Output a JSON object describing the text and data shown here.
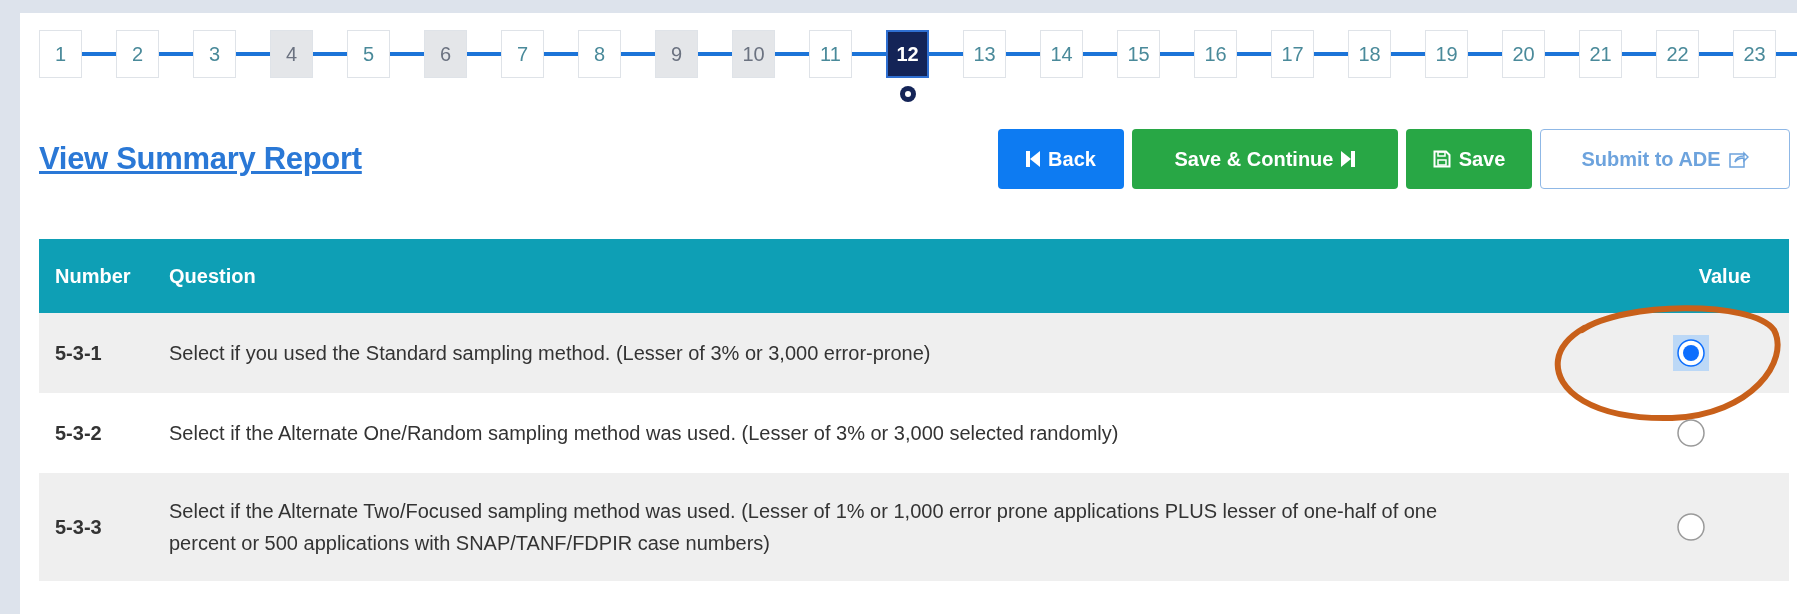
{
  "steps": [
    {
      "label": "1",
      "selected": false,
      "greyed": false
    },
    {
      "label": "2",
      "selected": false,
      "greyed": false
    },
    {
      "label": "3",
      "selected": false,
      "greyed": false
    },
    {
      "label": "4",
      "selected": false,
      "greyed": true
    },
    {
      "label": "5",
      "selected": false,
      "greyed": false
    },
    {
      "label": "6",
      "selected": false,
      "greyed": true
    },
    {
      "label": "7",
      "selected": false,
      "greyed": false
    },
    {
      "label": "8",
      "selected": false,
      "greyed": false
    },
    {
      "label": "9",
      "selected": false,
      "greyed": true
    },
    {
      "label": "10",
      "selected": false,
      "greyed": true
    },
    {
      "label": "11",
      "selected": false,
      "greyed": false
    },
    {
      "label": "12",
      "selected": true,
      "greyed": false
    },
    {
      "label": "13",
      "selected": false,
      "greyed": false
    },
    {
      "label": "14",
      "selected": false,
      "greyed": false
    },
    {
      "label": "15",
      "selected": false,
      "greyed": false
    },
    {
      "label": "16",
      "selected": false,
      "greyed": false
    },
    {
      "label": "17",
      "selected": false,
      "greyed": false
    },
    {
      "label": "18",
      "selected": false,
      "greyed": false
    },
    {
      "label": "19",
      "selected": false,
      "greyed": false
    },
    {
      "label": "20",
      "selected": false,
      "greyed": false
    },
    {
      "label": "21",
      "selected": false,
      "greyed": false
    },
    {
      "label": "22",
      "selected": false,
      "greyed": false
    },
    {
      "label": "23",
      "selected": false,
      "greyed": false
    }
  ],
  "summary_link": "View Summary Report",
  "buttons": [
    {
      "label": "Back",
      "kind": "back"
    },
    {
      "label": "Save & Continue",
      "kind": "continue"
    },
    {
      "label": "Save",
      "kind": "save"
    },
    {
      "label": "Submit to ADE",
      "kind": "submit"
    }
  ],
  "table": {
    "columns": [
      "Number",
      "Question",
      "Value"
    ],
    "rows": [
      {
        "number": "5-3-1",
        "question": "Select if you used the Standard sampling method. (Lesser of 3% or 3,000 error-prone)",
        "selected": true
      },
      {
        "number": "5-3-2",
        "question": "Select if the Alternate One/Random sampling method was used. (Lesser of 3% or 3,000 selected randomly)",
        "selected": false
      },
      {
        "number": "5-3-3",
        "question": "Select if the Alternate Two/Focused sampling method was used. (Lesser of 1% or 1,000 error prone applications PLUS lesser of one-half of one percent or 500 applications with SNAP/TANF/FDPIR case numbers)",
        "selected": false
      }
    ]
  }
}
